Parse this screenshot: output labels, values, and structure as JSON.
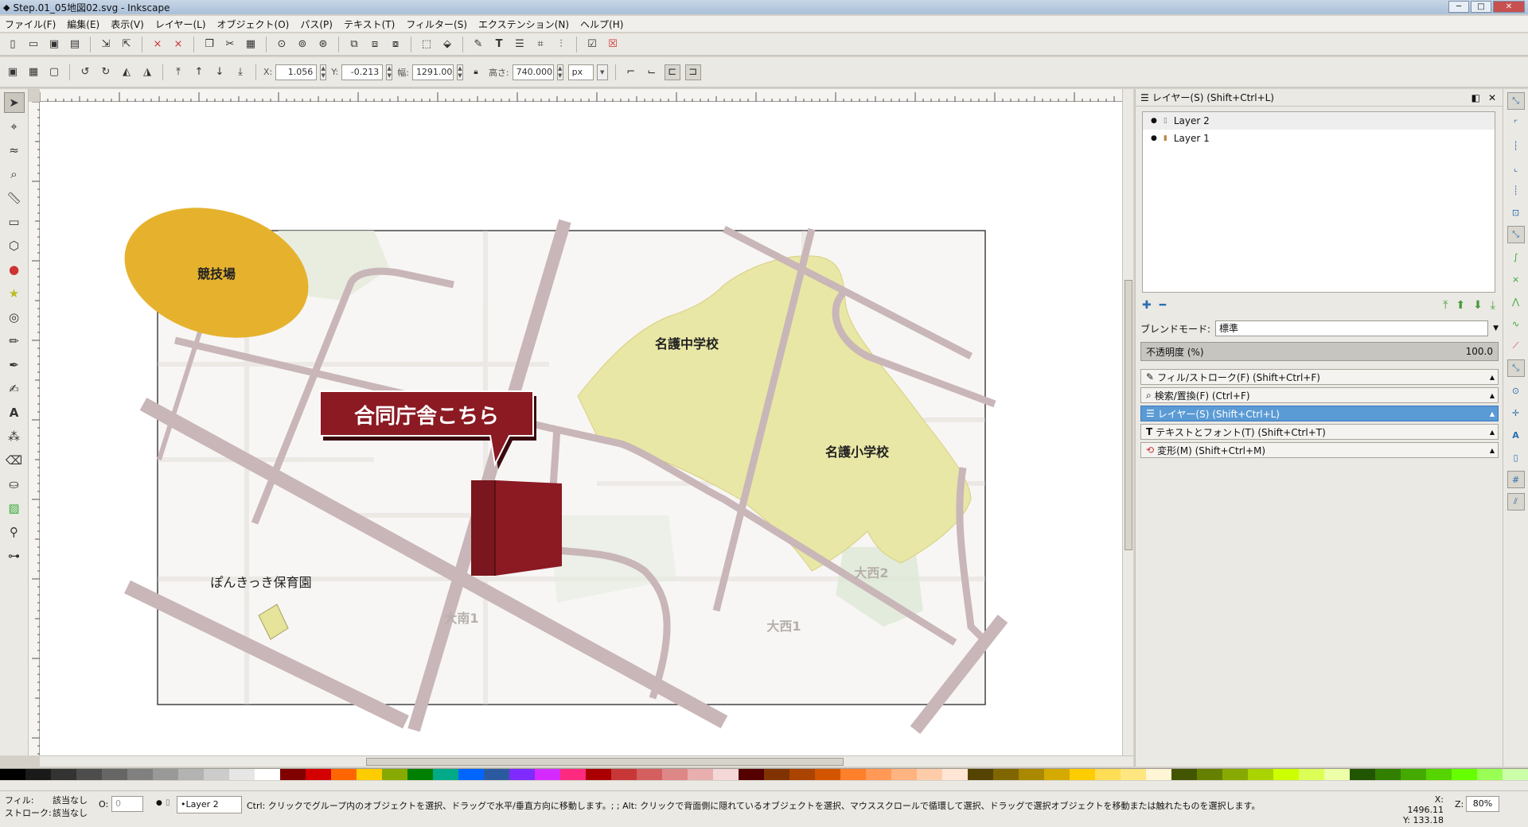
{
  "window": {
    "title": "Step.01_05地図02.svg - Inkscape"
  },
  "menu": [
    "ファイル(F)",
    "編集(E)",
    "表示(V)",
    "レイヤー(L)",
    "オブジェクト(O)",
    "パス(P)",
    "テキスト(T)",
    "フィルター(S)",
    "エクステンション(N)",
    "ヘルプ(H)"
  ],
  "toolbar": {
    "x_label": "X:",
    "x_value": "1.056",
    "y_label": "Y:",
    "y_value": "-0.213",
    "w_label": "幅:",
    "w_value": "1291.00",
    "h_label": "高さ:",
    "h_value": "740.000",
    "unit": "px"
  },
  "canvas": {
    "label_stadium": "競技場",
    "label_callout": "合同庁舎こちら",
    "label_jhs": "名護中学校",
    "label_es": "名護小学校",
    "label_nursery": "ぽんきっき保育園",
    "label_dainan": "大南1",
    "label_dainishi1": "大西1",
    "label_dainishi2": "大西2",
    "colors": {
      "stadium": "#e6b22e",
      "callout": "#8b1a22",
      "school": "#e8e7a6",
      "road": "#c9b6b8"
    }
  },
  "layers_panel": {
    "title": "レイヤー(S) (Shift+Ctrl+L)",
    "layers": [
      "Layer 2",
      "Layer 1"
    ],
    "blend_label": "ブレンドモード:",
    "blend_value": "標準",
    "opacity_label": "不透明度 (%)",
    "opacity_value": "100.0",
    "dialogs": [
      "フィル/ストローク(F) (Shift+Ctrl+F)",
      "検索/置換(F) (Ctrl+F)",
      "レイヤー(S) (Shift+Ctrl+L)",
      "テキストとフォント(T) (Shift+Ctrl+T)",
      "変形(M) (Shift+Ctrl+M)"
    ]
  },
  "status": {
    "fill_label": "フィル:",
    "fill_value": "該当なし",
    "stroke_label": "ストローク:",
    "stroke_value": "該当なし",
    "o_label": "O:",
    "o_value": "0",
    "current_layer": "•Layer 2",
    "message": "Ctrl: クリックでグループ内のオブジェクトを選択、ドラッグで水平/垂直方向に移動します。; ; Alt: クリックで背面側に隠れているオブジェクトを選択、マウススクロールで循環して選択、ドラッグで選択オブジェクトを移動または触れたものを選択します。",
    "cursor_x": "X: 1496.11",
    "cursor_y": "Y:  133.18",
    "zoom_label": "Z:",
    "zoom": "80%"
  },
  "palette": [
    "#000000",
    "#1a1a1a",
    "#333333",
    "#4d4d4d",
    "#666666",
    "#808080",
    "#999999",
    "#b3b3b3",
    "#cccccc",
    "#e6e6e6",
    "#ffffff",
    "#800000",
    "#d40000",
    "#ff6600",
    "#ffcc00",
    "#88aa00",
    "#008000",
    "#00aa88",
    "#0066ff",
    "#2c5aa0",
    "#7f2aff",
    "#d42aff",
    "#ff2a7f",
    "#aa0000",
    "#c83737",
    "#d35f5f",
    "#de8787",
    "#e9afaf",
    "#f4d7d7",
    "#550000",
    "#803300",
    "#aa4400",
    "#d45500",
    "#ff7f2a",
    "#ff9955",
    "#ffb380",
    "#ffccaa",
    "#ffe6d5",
    "#554400",
    "#806600",
    "#aa8800",
    "#d4aa00",
    "#ffcc00",
    "#ffdd55",
    "#ffe680",
    "#fff6d5",
    "#445500",
    "#668000",
    "#88aa00",
    "#aad400",
    "#ccff00",
    "#ddff55",
    "#eeffaa",
    "#225500",
    "#338000",
    "#44aa00",
    "#55d400",
    "#66ff00",
    "#99ff55",
    "#ccffaa"
  ]
}
